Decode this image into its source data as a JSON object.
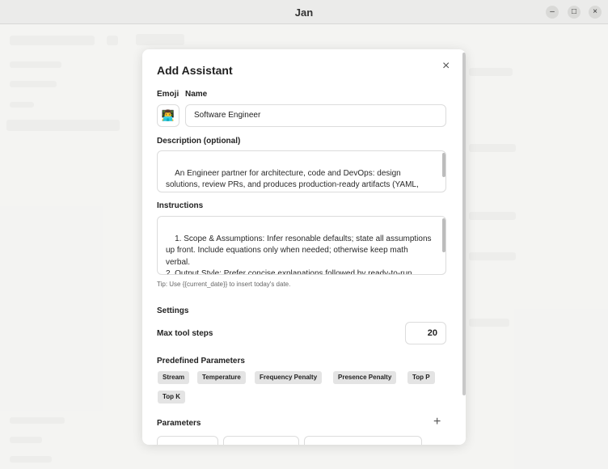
{
  "window": {
    "title": "Jan",
    "minimize_glyph": "–",
    "maximize_glyph": "□",
    "close_glyph": "×"
  },
  "modal": {
    "title": "Add Assistant",
    "close_glyph": "×",
    "emoji_label": "Emoji",
    "emoji_value": "👨‍💻",
    "name_label": "Name",
    "name_value": "Software Engineer",
    "description_label": "Description (optional)",
    "description_value": "An Engineer partner for architecture, code and DevOps: design solutions, review PRs, and produces production-ready artifacts (YAML, Dockerfiles, GitHub Actions) across Kubernetes, cloud and",
    "instructions_label": "Instructions",
    "instructions_value": "1. Scope & Assumptions: Infer resonable defaults; state all assumptions up front. Include equations only when needed; otherwise keep math verbal.\n2. Output Style: Prefer concise explanations followed by ready-to-run artifacts: code blocks, commands, configs, and checklists. Use",
    "tip": "Tip: Use {{current_date}} to insert today's date.",
    "settings_label": "Settings",
    "max_tool_steps_label": "Max tool steps",
    "max_tool_steps_value": "20",
    "predefined_label": "Predefined Parameters",
    "predefined": [
      "Stream",
      "Temperature",
      "Frequency Penalty",
      "Presence Penalty",
      "Top P",
      "Top K"
    ],
    "parameters_label": "Parameters",
    "add_glyph": "+"
  }
}
